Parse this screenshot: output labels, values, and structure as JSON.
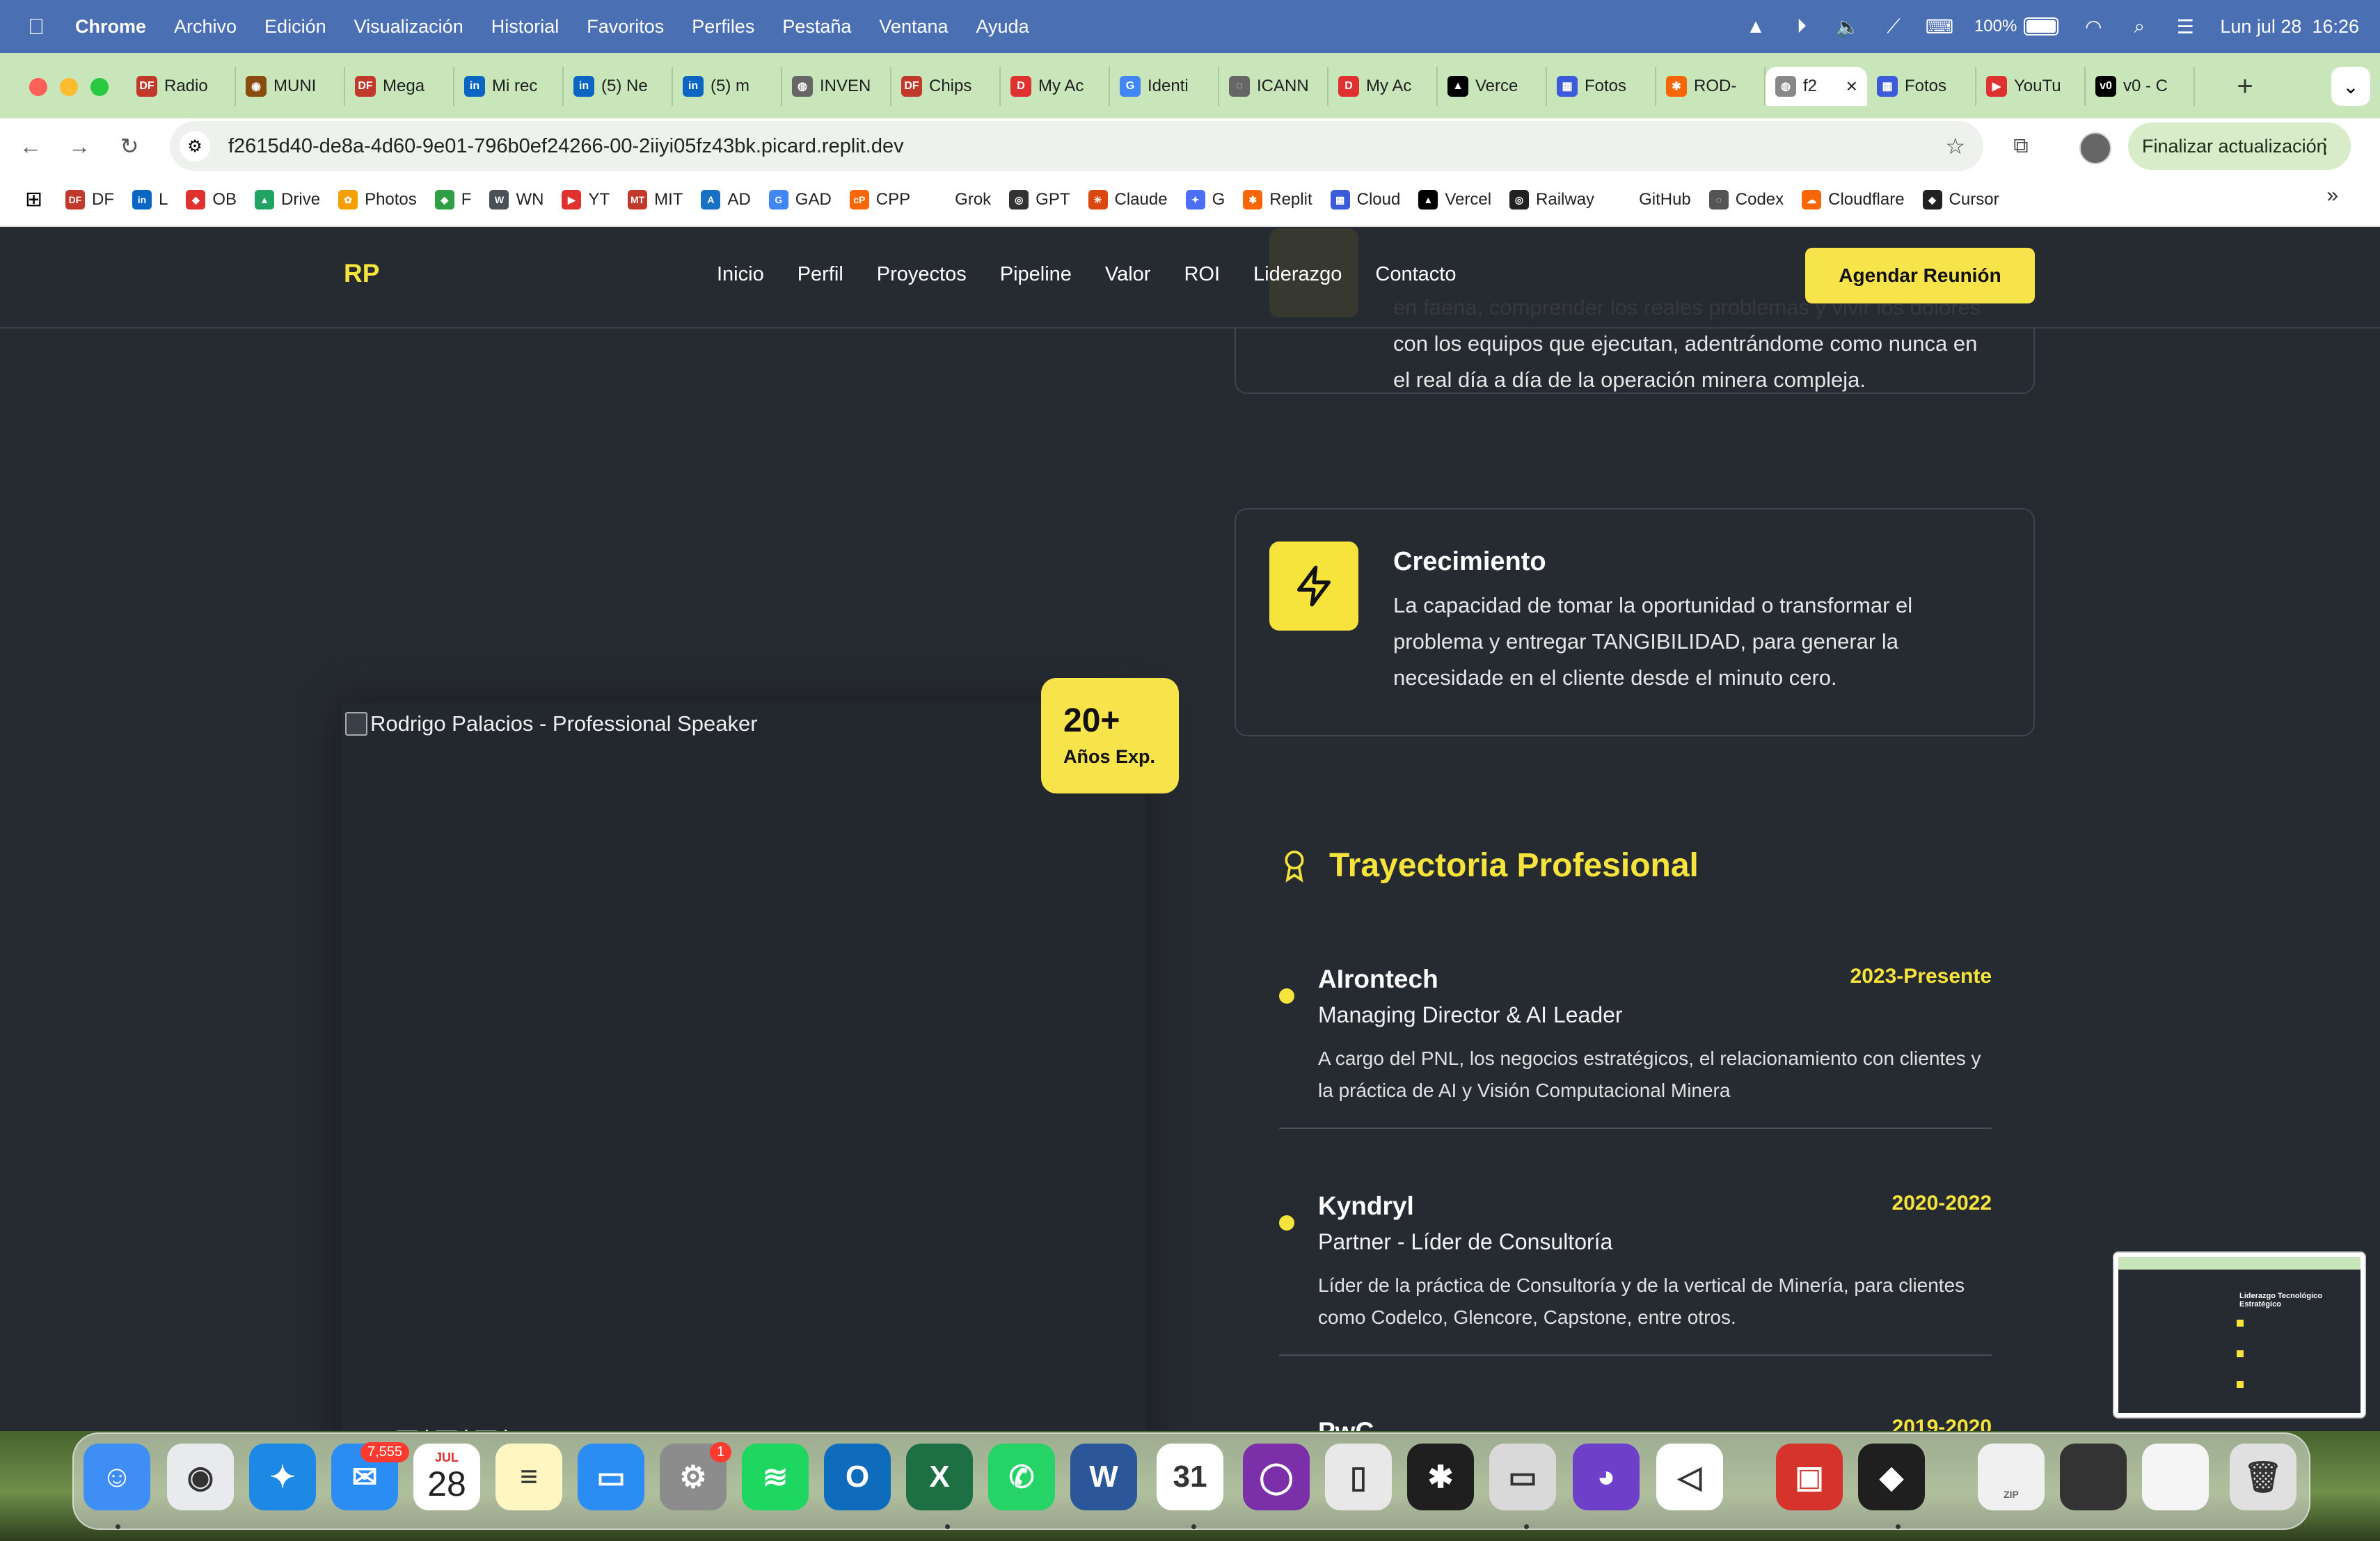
{
  "menubar": {
    "app_name": "Chrome",
    "items": [
      "Archivo",
      "Edición",
      "Visualización",
      "Historial",
      "Favoritos",
      "Perfiles",
      "Pestaña",
      "Ventana",
      "Ayuda"
    ],
    "battery": "100%",
    "datetime": "Lun jul 28  16:26"
  },
  "tabs": [
    {
      "label": "Radio",
      "fav": "DF",
      "color": "#c0392b"
    },
    {
      "label": "MUNI",
      "fav": "◉",
      "color": "#8a4b0f"
    },
    {
      "label": "Mega",
      "fav": "DF",
      "color": "#c0392b"
    },
    {
      "label": "Mi rec",
      "fav": "in",
      "color": "#0a66c2"
    },
    {
      "label": "(5) Ne",
      "fav": "in",
      "color": "#0a66c2"
    },
    {
      "label": "(5) m",
      "fav": "in",
      "color": "#0a66c2"
    },
    {
      "label": "INVEN",
      "fav": "◍",
      "color": "#666"
    },
    {
      "label": "Chips",
      "fav": "DF",
      "color": "#c0392b"
    },
    {
      "label": "My Ac",
      "fav": "D",
      "color": "#e03131"
    },
    {
      "label": "Identi",
      "fav": "G",
      "color": "#4285f4"
    },
    {
      "label": "ICANN",
      "fav": "◌",
      "color": "#666"
    },
    {
      "label": "My Ac",
      "fav": "D",
      "color": "#e03131"
    },
    {
      "label": "Verce",
      "fav": "▲",
      "color": "#000"
    },
    {
      "label": "Fotos",
      "fav": "▦",
      "color": "#3b5bdb"
    },
    {
      "label": "ROD-",
      "fav": "✱",
      "color": "#f76707"
    }
  ],
  "active_tab": {
    "label": "f2"
  },
  "tabs_after": [
    {
      "label": "Fotos",
      "fav": "▦",
      "color": "#3b5bdb"
    },
    {
      "label": "YouTu",
      "fav": "▶",
      "color": "#e03131"
    },
    {
      "label": "v0 - C",
      "fav": "v0",
      "color": "#000"
    }
  ],
  "omnibox": {
    "url": "f2615d40-de8a-4d60-9e01-796b0ef24266-00-2iiyi05fz43bk.picard.replit.dev"
  },
  "update_button": "Finalizar actualización",
  "bookmarks": [
    {
      "label": "DF",
      "fav": "DF",
      "color": "#c0392b"
    },
    {
      "label": "L",
      "fav": "in",
      "color": "#0a66c2"
    },
    {
      "label": "OB",
      "fav": "◆",
      "color": "#e03131"
    },
    {
      "label": "Drive",
      "fav": "▲",
      "color": "#1fa463"
    },
    {
      "label": "Photos",
      "fav": "✿",
      "color": "#f59f00"
    },
    {
      "label": "F",
      "fav": "◆",
      "color": "#2f9e44"
    },
    {
      "label": "WN",
      "fav": "W",
      "color": "#495057"
    },
    {
      "label": "YT",
      "fav": "▶",
      "color": "#e03131"
    },
    {
      "label": "MIT",
      "fav": "MT",
      "color": "#c0392b"
    },
    {
      "label": "AD",
      "fav": "A",
      "color": "#1971c2"
    },
    {
      "label": "GAD",
      "fav": "G",
      "color": "#4285f4"
    },
    {
      "label": "CPP",
      "fav": "cP",
      "color": "#f76707"
    },
    {
      "label": "Grok",
      "fav": "",
      "color": "#ffffff"
    },
    {
      "label": "GPT",
      "fav": "◎",
      "color": "#333"
    },
    {
      "label": "Claude",
      "fav": "✳",
      "color": "#d9480f"
    },
    {
      "label": "G",
      "fav": "✦",
      "color": "#4c6ef5"
    },
    {
      "label": "Replit",
      "fav": "✱",
      "color": "#f76707"
    },
    {
      "label": "Cloud",
      "fav": "▦",
      "color": "#3b5bdb"
    },
    {
      "label": "Vercel",
      "fav": "▲",
      "color": "#000"
    },
    {
      "label": "Railway",
      "fav": "◎",
      "color": "#222"
    },
    {
      "label": "GitHub",
      "fav": "",
      "color": "#ffffff"
    },
    {
      "label": "Codex",
      "fav": "◌",
      "color": "#555"
    },
    {
      "label": "Cloudflare",
      "fav": "☁",
      "color": "#f76707"
    },
    {
      "label": "Cursor",
      "fav": "◆",
      "color": "#222"
    }
  ],
  "site": {
    "logo": "RP",
    "nav": [
      "Inicio",
      "Perfil",
      "Proyectos",
      "Pipeline",
      "Valor",
      "ROI",
      "Liderazgo",
      "Contacto"
    ],
    "cta": "Agendar Reunión",
    "card_top": {
      "text": "en faena, comprender los reales problemas y vivir los dolores con los equipos que ejecutan, adentrándome como nunca en el real día a día de la operación minera compleja."
    },
    "card_growth": {
      "title": "Crecimiento",
      "text": "La capacidad de tomar la oportunidad o transformar el problema y entregar TANGIBILIDAD, para generar la necesidade en el cliente desde el minuto cero."
    },
    "photo_alt": "Rodrigo Palacios - Professional Speaker",
    "badge": {
      "number": "20+",
      "label": "Años Exp."
    },
    "section_title": "Trayectoria Profesional",
    "timeline": [
      {
        "company": "AIrontech",
        "period": "2023-Presente",
        "role": "Managing Director & AI Leader",
        "desc": "A cargo del PNL, los negocios estratégicos, el relacionamiento con clientes y la práctica de AI y Visión Computacional Minera"
      },
      {
        "company": "Kyndryl",
        "period": "2020-2022",
        "role": "Partner - Líder de Consultoría",
        "desc": "Líder de la práctica de Consultoría y de la vertical de Minería, para clientes como Codelco, Glencore, Capstone, entre otros."
      },
      {
        "company": "PwC",
        "period": "2019-2020",
        "role": "",
        "desc": ""
      }
    ]
  },
  "thumbnail": {
    "title": "Liderazgo Tecnológico Estratégico"
  },
  "dock": {
    "mail_badge": "7,555",
    "calendar_month": "JUL",
    "calendar_day": "28",
    "settings_badge": "1",
    "zip_label": "ZIP",
    "apps": [
      {
        "name": "finder-icon",
        "color": "#3f8ef5",
        "glyph": "☺"
      },
      {
        "name": "chrome-icon",
        "color": "#e8eaed",
        "glyph": "◉"
      },
      {
        "name": "safari-icon",
        "color": "#1e88e5",
        "glyph": "✦"
      },
      {
        "name": "mail-icon",
        "color": "#2b8cf4",
        "glyph": "✉"
      },
      {
        "name": "calendar-icon",
        "color": "#ffffff",
        "glyph": ""
      },
      {
        "name": "notes-icon",
        "color": "#fff6c2",
        "glyph": "≡"
      },
      {
        "name": "keynote-icon",
        "color": "#2b8cf4",
        "glyph": "▭"
      },
      {
        "name": "system-settings-icon",
        "color": "#8c8c8c",
        "glyph": "⚙"
      },
      {
        "name": "spotify-icon",
        "color": "#1ed760",
        "glyph": "≋"
      },
      {
        "name": "outlook-icon",
        "color": "#0f6cbd",
        "glyph": "O"
      },
      {
        "name": "excel-icon",
        "color": "#1d7044",
        "glyph": "X"
      },
      {
        "name": "whatsapp-icon",
        "color": "#25d366",
        "glyph": "✆"
      },
      {
        "name": "word-icon",
        "color": "#2b579a",
        "glyph": "W"
      },
      {
        "name": "fantastical-icon",
        "color": "#ffffff",
        "glyph": "31"
      },
      {
        "name": "circle-app-icon",
        "color": "#7b2fa8",
        "glyph": "◯"
      },
      {
        "name": "iphone-mirroring-icon",
        "color": "#e8e8e8",
        "glyph": "▯"
      },
      {
        "name": "replit-icon",
        "color": "#1f1f1f",
        "glyph": "✱"
      },
      {
        "name": "preview-icon",
        "color": "#d9d9d9",
        "glyph": "▭"
      },
      {
        "name": "github-desktop-icon",
        "color": "#6e40c9",
        "glyph": "◕"
      },
      {
        "name": "vscode-icon",
        "color": "#ffffff",
        "glyph": "◁"
      },
      {
        "name": "photo-booth-icon",
        "color": "#d6332c",
        "glyph": "▣"
      },
      {
        "name": "cube-app-icon",
        "color": "#1f1f1f",
        "glyph": "◆"
      },
      {
        "name": "zip-file-icon",
        "color": "#f0f0f0",
        "glyph": ""
      },
      {
        "name": "recent-window-1-icon",
        "color": "#333",
        "glyph": ""
      },
      {
        "name": "recent-window-2-icon",
        "color": "#f5f5f5",
        "glyph": ""
      },
      {
        "name": "trash-icon",
        "color": "#e0e0e0",
        "glyph": "🗑"
      }
    ]
  }
}
